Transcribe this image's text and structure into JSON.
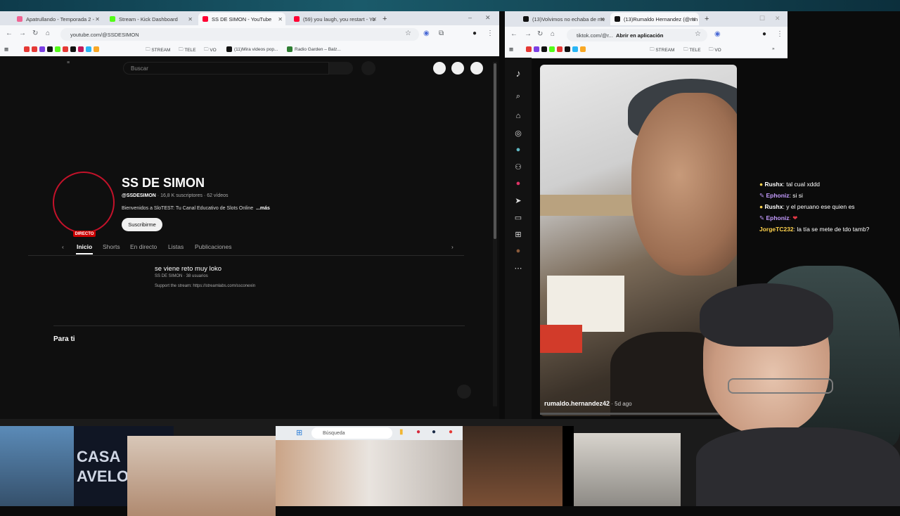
{
  "left_browser": {
    "tabs": [
      {
        "label": "Apatrullando - Temporada 2 - ",
        "color": "#f06292"
      },
      {
        "label": "Stream - Kick Dashboard",
        "color": "#53fc18"
      },
      {
        "label": "SS DE SIMON - YouTube",
        "color": "#ff0033"
      },
      {
        "label": "(59) you laugh, you restart - Yo",
        "color": "#ff0033"
      }
    ],
    "url": "youtube.com/@SSDESIMON",
    "bookmarks": [
      "STREAM",
      "TELE",
      "VO",
      "(11)Mira videos pop...",
      "Radio Garden – Balz..."
    ]
  },
  "youtube": {
    "search_placeholder": "Buscar",
    "live_badge": "DIRECTO",
    "channel_name": "SS DE SIMON",
    "handle": "@SSDESIMON",
    "meta": " · 16,8 K suscriptores · 62 vídeos",
    "description": "Bienvenidos a SloTEST: Tu Canal Educativo de Slots Online",
    "more_label": "...más",
    "subscribe_label": "Suscribirme",
    "tabs": [
      "Inicio",
      "Shorts",
      "En directo",
      "Listas",
      "Publicaciones"
    ],
    "live_title": "se viene reto muy loko",
    "live_subtitle": "SS DE SIMON · 38 usuarios",
    "live_link": "Support the stream: https://streamlabs.com/ssconexin",
    "section_title": "Para ti"
  },
  "right_browser": {
    "tabs": [
      {
        "label": "(13)Volvimos no echaba de me",
        "color": "#111111"
      },
      {
        "label": "(13)Rumaldo Hernandez (@run",
        "color": "#111111"
      }
    ],
    "url": "tiktok.com/@r...",
    "open_app": "Abrir en aplicación",
    "bookmarks": [
      "STREAM",
      "TELE",
      "VO"
    ]
  },
  "tiktok": {
    "username": "rumaldo.hernandez42",
    "age": " · 5d ago"
  },
  "chat": [
    {
      "user": "Rushx",
      "text": ": tal cual xddd",
      "color": "#ffd34d"
    },
    {
      "user": "Ephoniz",
      "text": ": si si",
      "color": "#c49bff"
    },
    {
      "user": "Rushx",
      "text": ": y el peruano ese quien es",
      "color": "#ffd34d"
    },
    {
      "user": "Ephoniz",
      "text": ": ❤",
      "color": "#c49bff"
    },
    {
      "user": "JorgeTC232",
      "text": ": la tía se mete de tdo tamb?",
      "color": "#ffd34d"
    }
  ],
  "taskbar": {
    "search_placeholder": "Búsqueda"
  },
  "casa_text": "CASA\nAVELO"
}
